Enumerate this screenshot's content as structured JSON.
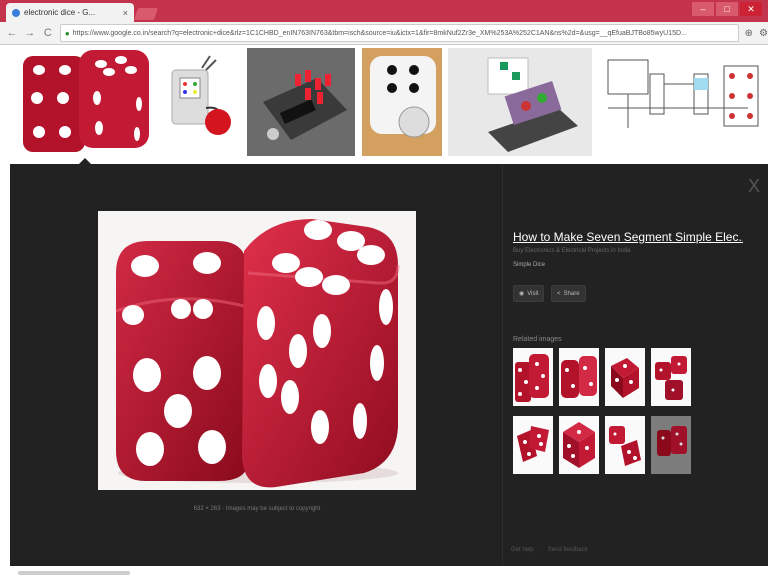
{
  "browser": {
    "tab_title": "electronic dice - G...",
    "tab_close": "×",
    "url": "https://www.google.co.in/search?q=electronic+dice&rlz=1C1CHBD_enIN763IN763&tbm=isch&source=iu&ictx=1&fir=8mkNuf2Zr3e_XM%253A%252C1AN&ns%2d=&usg=__qEfuaBJTBo85wyU15D...",
    "back": "←",
    "forward": "→",
    "reload": "C",
    "window_buttons": [
      "–",
      "□",
      "✕"
    ],
    "toolbar_icons": [
      "⊕",
      "⚙"
    ]
  },
  "viewer": {
    "close_glyph": "X",
    "title": "How to Make Seven Segment Simple Elec...",
    "source_site": "Buy Electronics & Electrical Projects in India",
    "subtitle": "Simple Dice",
    "visit_label": "Visit",
    "share_label": "Share",
    "related_label": "Related images",
    "caption_size": "632 × 263",
    "caption_note": "Images may be subject to copyright",
    "footer_help": "Get help",
    "footer_feedback": "Send feedback"
  },
  "colors": {
    "chrome_bar": "#c3334b",
    "dice_red": "#b3122b",
    "panel_bg": "#222222"
  }
}
